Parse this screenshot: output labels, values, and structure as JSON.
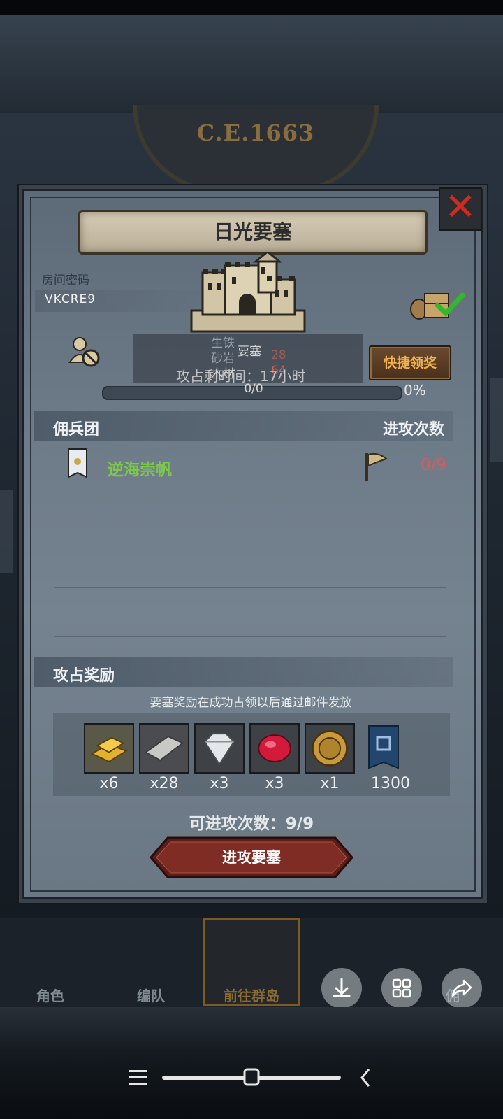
{
  "background": {
    "year_label": "C.E.1663"
  },
  "dialog": {
    "title": "日光要塞",
    "room_code_label": "房间密码",
    "room_code": "VKCRE9",
    "overlapping_info": {
      "line_a": "生铁",
      "line_b": "砂岩",
      "line_b_value": "28",
      "line_c": "要塞",
      "line_d": "木材",
      "line_d_value": "64",
      "occupy_time": "攻占剩时间：17小时"
    },
    "quick_claim_label": "快捷领奖",
    "progress": {
      "text": "0/0",
      "percent_label": "0%",
      "fill_fraction": 0
    },
    "mercenary_header": "佣兵团",
    "attacks_header": "进攻次数",
    "mercenaries": [
      {
        "name": "逆海崇帆",
        "attacks": "0/9"
      }
    ],
    "rewards_header": "攻占奖励",
    "rewards_note": "要塞奖励在成功占领以后通过邮件发放",
    "rewards": [
      {
        "icon": "gold-bar-icon",
        "qty": "x6"
      },
      {
        "icon": "iron-bar-icon",
        "qty": "x28"
      },
      {
        "icon": "diamond-icon",
        "qty": "x3"
      },
      {
        "icon": "ruby-icon",
        "qty": "x3"
      },
      {
        "icon": "medal-icon",
        "qty": "x1"
      },
      {
        "icon": "banner-icon",
        "qty": "1300"
      }
    ],
    "attack_times": "可进攻次数：9/9",
    "attack_button": "进攻要塞"
  },
  "bottom_nav": {
    "tabs": [
      "角色",
      "编队",
      "前往群岛",
      "",
      "佣"
    ]
  },
  "floating_buttons": [
    "download-icon",
    "grid-icon",
    "share-icon"
  ],
  "colors": {
    "merc_name": "#7cc84a",
    "attack_count": "#d85c5c",
    "quick_claim_text": "#f2b14a",
    "close": "#d22a1e"
  }
}
